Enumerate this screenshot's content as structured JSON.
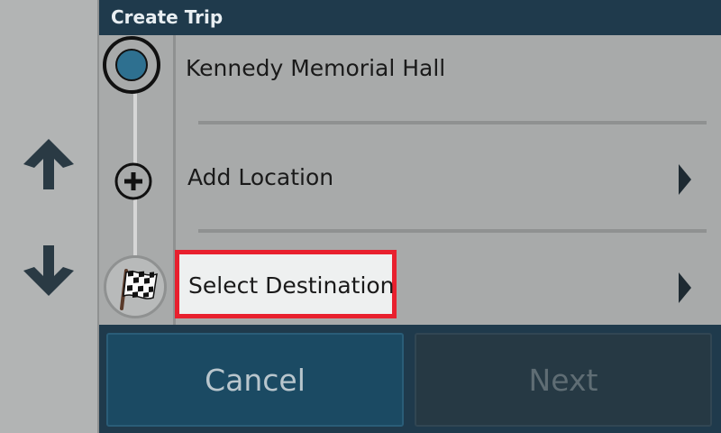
{
  "header": {
    "title": "Create Trip"
  },
  "nav": {
    "up_icon": "arrow-up-icon",
    "down_icon": "arrow-down-icon"
  },
  "trip": {
    "origin": {
      "label": "Kennedy Memorial Hall",
      "icon": "origin-marker-icon"
    },
    "add": {
      "label": "Add Location",
      "icon": "add-circle-icon"
    },
    "destination": {
      "label": "Select Destination",
      "icon": "checkered-flag-icon"
    }
  },
  "buttons": {
    "cancel": "Cancel",
    "next": "Next",
    "next_enabled": false
  },
  "colors": {
    "header_bg": "#1f3a4c",
    "accent_blue": "#2e7090",
    "highlight": "#e8202e",
    "cancel_bg": "#1b4a63",
    "next_bg": "#263944"
  }
}
